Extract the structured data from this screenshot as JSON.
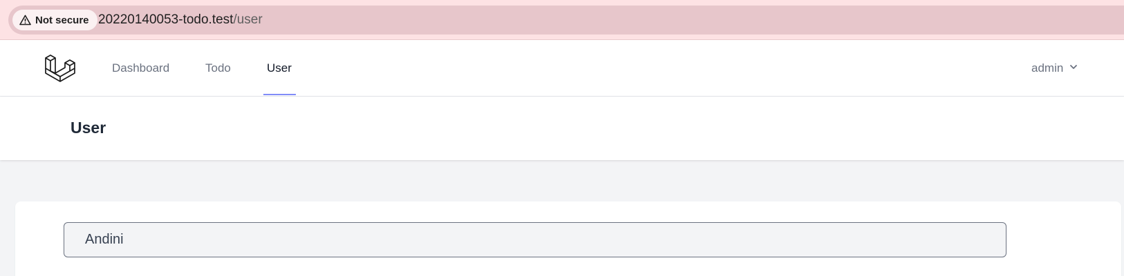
{
  "browser": {
    "security_label": "Not secure",
    "url_host": "20220140053-todo.test",
    "url_path": "/user",
    "security_icon": "warning-triangle-icon"
  },
  "nav": {
    "logo_icon": "laravel-logo-icon",
    "links": [
      {
        "label": "Dashboard",
        "active": false
      },
      {
        "label": "Todo",
        "active": false
      },
      {
        "label": "User",
        "active": true
      }
    ],
    "user_name": "admin",
    "user_menu_icon": "chevron-down-icon"
  },
  "header": {
    "title": "User"
  },
  "main": {
    "name_value": "Andini"
  },
  "colors": {
    "browser_bar_bg": "#fde2e4",
    "active_tab_indicator": "#818cf8",
    "page_bg": "#f3f4f6"
  }
}
